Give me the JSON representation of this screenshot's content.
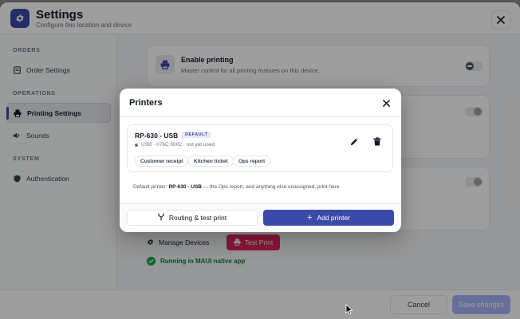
{
  "header": {
    "title": "Settings",
    "subtitle": "Configure this location and device"
  },
  "sidebar": {
    "sections": [
      {
        "label": "ORDERS",
        "items": [
          {
            "label": "Order Settings",
            "icon": "receipt-icon"
          }
        ]
      },
      {
        "label": "OPERATIONS",
        "items": [
          {
            "label": "Printing Settings",
            "icon": "printer-icon",
            "active": true
          },
          {
            "label": "Sounds",
            "icon": "speaker-icon"
          }
        ]
      },
      {
        "label": "SYSTEM",
        "items": [
          {
            "label": "Authentication",
            "icon": "shield-icon"
          }
        ]
      }
    ]
  },
  "main": {
    "enable_printing": {
      "title": "Enable printing",
      "description": "Master control for all printing features on this device."
    },
    "manage_devices_label": "Manage Devices",
    "test_print_label": "Test Print",
    "status_text": "Running in MAUI native app"
  },
  "footer": {
    "cancel_label": "Cancel",
    "save_label": "Save changes"
  },
  "modal": {
    "title": "Printers",
    "printer": {
      "name": "RP-630 - USB",
      "badge": "DEFAULT",
      "meta": "USB · 076C:0002 · not yet used",
      "chips": [
        "Customer receipt",
        "Kitchen ticket",
        "Ops report"
      ]
    },
    "note_prefix": "Default printer: ",
    "note_printer": "RP-630 - USB",
    "note_suffix": " — the Ops report, and anything else unassigned, print here.",
    "routing_label": "Routing & test print",
    "add_label": "Add printer"
  },
  "colors": {
    "accent": "#3b4aa8",
    "danger": "#e0245e",
    "success": "#16a34a"
  }
}
